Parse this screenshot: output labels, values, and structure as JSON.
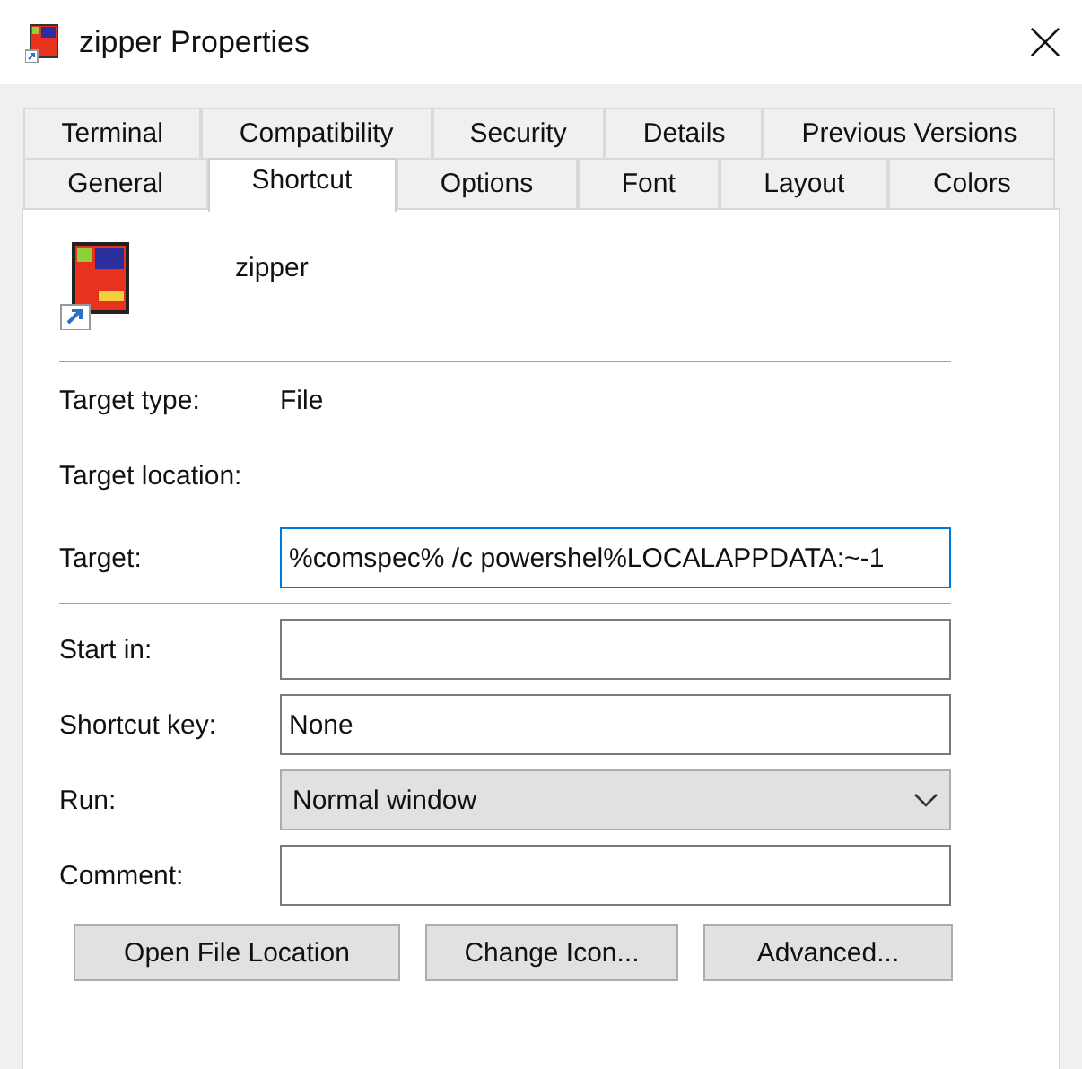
{
  "window": {
    "title": "zipper Properties"
  },
  "tab_rows": [
    [
      {
        "label": "Terminal",
        "selected": false
      },
      {
        "label": "Compatibility",
        "selected": false
      },
      {
        "label": "Security",
        "selected": false
      },
      {
        "label": "Details",
        "selected": false
      },
      {
        "label": "Previous Versions",
        "selected": false
      }
    ],
    [
      {
        "label": "General",
        "selected": false
      },
      {
        "label": "Shortcut",
        "selected": true
      },
      {
        "label": "Options",
        "selected": false
      },
      {
        "label": "Font",
        "selected": false
      },
      {
        "label": "Layout",
        "selected": false
      },
      {
        "label": "Colors",
        "selected": false
      }
    ]
  ],
  "shortcut_name": "zipper",
  "info": [
    {
      "label": "Target type:",
      "value": "File"
    },
    {
      "label": "Target location:"
    }
  ],
  "target": {
    "label": "Target:",
    "value": "%comspec% /c powershel%LOCALAPPDATA:~-1",
    "focused": true
  },
  "fields": [
    {
      "kind": "text",
      "label": "Start in:"
    },
    {
      "kind": "text",
      "label": "Shortcut key:",
      "value": "None"
    },
    {
      "kind": "dropdown",
      "label": "Run:",
      "value": "Normal window"
    },
    {
      "kind": "text",
      "label": "Comment:"
    }
  ],
  "buttons": [
    "Open File Location",
    "Change Icon...",
    "Advanced..."
  ]
}
